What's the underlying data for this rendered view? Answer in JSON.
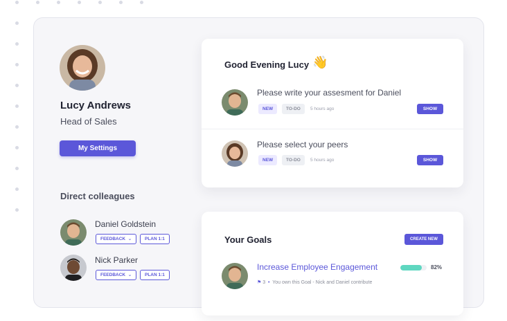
{
  "profile": {
    "name": "Lucy Andrews",
    "role": "Head of Sales",
    "settings_label": "My Settings"
  },
  "colleagues": {
    "title": "Direct colleagues",
    "items": [
      {
        "name": "Daniel Goldstein",
        "feedback_label": "FEEDBACK",
        "plan_label": "PLAN 1:1"
      },
      {
        "name": "Nick Parker",
        "feedback_label": "FEEDBACK",
        "plan_label": "PLAN 1:1"
      }
    ]
  },
  "greeting": {
    "title": "Good Evening Lucy",
    "emoji": "👋",
    "tasks": [
      {
        "text": "Please write your assesment for Daniel",
        "tag_new": "NEW",
        "tag_todo": "TO-DO",
        "time": "5 hours ago",
        "action": "SHOW"
      },
      {
        "text": "Please select your peers",
        "tag_new": "NEW",
        "tag_todo": "TO-DO",
        "time": "5 hours ago",
        "action": "SHOW"
      }
    ]
  },
  "goals": {
    "title": "Your Goals",
    "create_label": "CREATE NEW",
    "items": [
      {
        "title": "Increase Employee Engagement",
        "progress": 82,
        "progress_label": "82%",
        "flag_count": "3",
        "meta": "You own this Goal - Nick and Daniel contribute"
      }
    ]
  },
  "colors": {
    "accent": "#5b57d9",
    "progress": "#5fd7c0",
    "panel_bg": "#f6f6f9"
  },
  "icons": [
    "waving-hand-icon",
    "chevron-down-icon",
    "flag-icon"
  ]
}
